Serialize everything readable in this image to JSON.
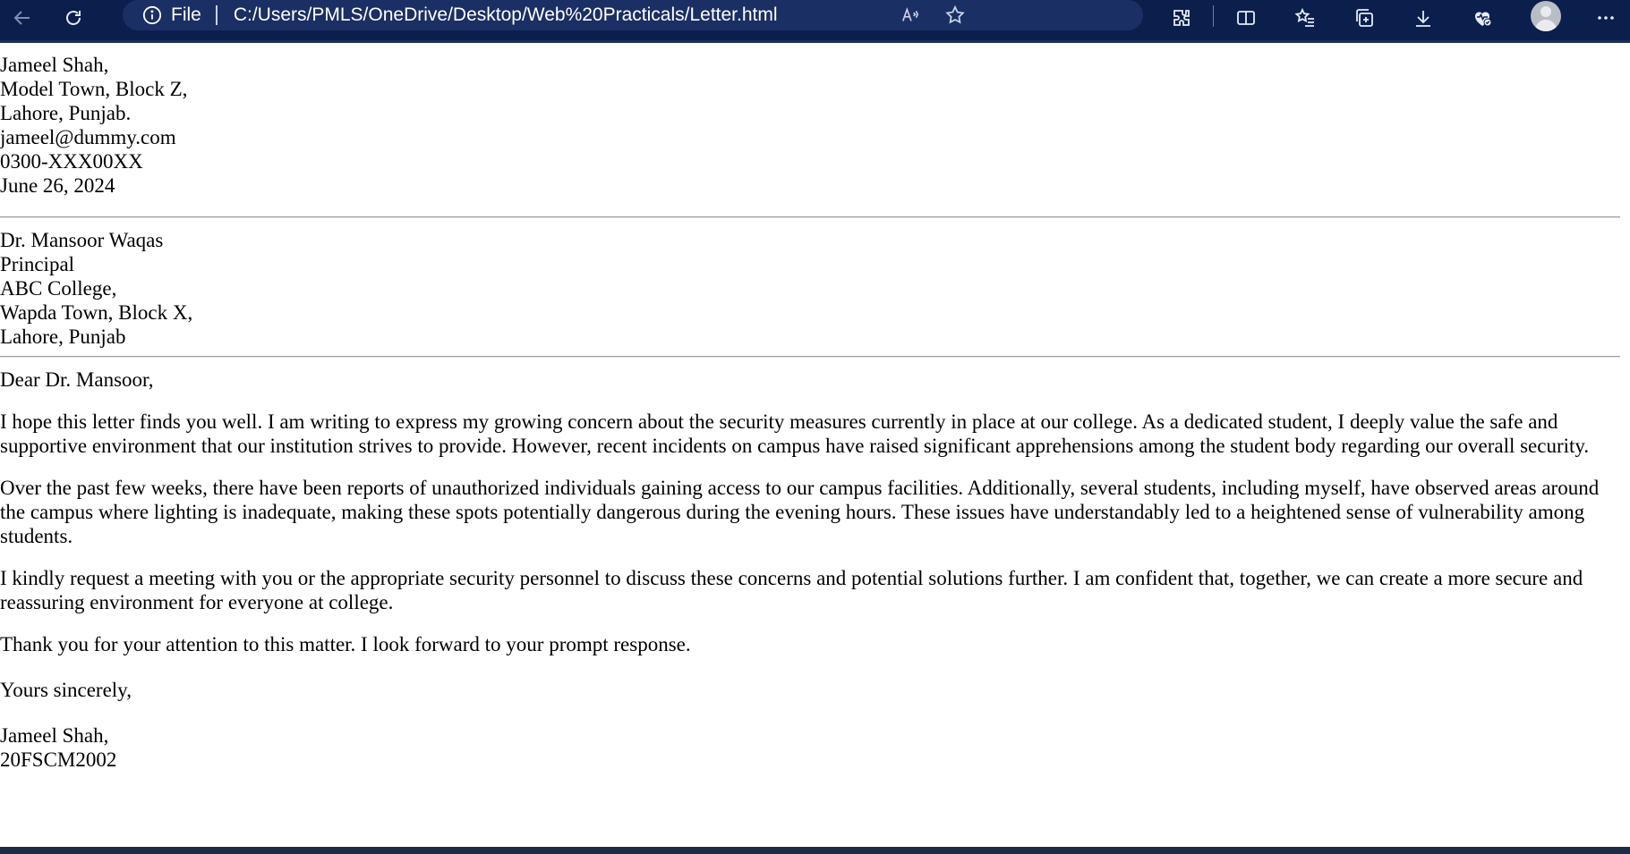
{
  "browser": {
    "file_label": "File",
    "url": "C:/Users/PMLS/OneDrive/Desktop/Web%20Practicals/Letter.html",
    "icons": [
      "back-arrow-icon",
      "refresh-icon",
      "info-icon",
      "read-aloud-icon",
      "favorite-star-icon",
      "extensions-icon",
      "split-screen-icon",
      "favorites-icon",
      "collections-icon",
      "download-icon",
      "browser-essentials-icon",
      "profile-avatar-icon",
      "more-menu-icon"
    ],
    "colors": {
      "toolbar": "#0b1f4d",
      "address_bar": "#1a2f63",
      "text": "#ffffff"
    }
  },
  "letter": {
    "sender": [
      "Jameel Shah,",
      "Model Town, Block Z,",
      "Lahore, Punjab.",
      "jameel@dummy.com",
      "0300-XXX00XX",
      "June 26, 2024"
    ],
    "recipient": [
      "Dr. Mansoor Waqas",
      "Principal",
      "ABC College,",
      "Wapda Town, Block X,",
      "Lahore, Punjab"
    ],
    "salutation": "Dear Dr. Mansoor,",
    "paragraphs": [
      "I hope this letter finds you well. I am writing to express my growing concern about the security measures currently in place at our college. As a dedicated student, I deeply value the safe and supportive environment that our institution strives to provide. However, recent incidents on campus have raised significant apprehensions among the student body regarding our overall security.",
      "Over the past few weeks, there have been reports of unauthorized individuals gaining access to our campus facilities. Additionally, several students, including myself, have observed areas around the campus where lighting is inadequate, making these spots potentially dangerous during the evening hours. These issues have understandably led to a heightened sense of vulnerability among students.",
      "I kindly request a meeting with you or the appropriate security personnel to discuss these concerns and potential solutions further. I am confident that, together, we can create a more secure and reassuring environment for everyone at college.",
      "Thank you for your attention to this matter. I look forward to your prompt response."
    ],
    "closing": "Yours sincerely,",
    "signature": [
      "Jameel Shah,",
      "20FSCM2002"
    ]
  }
}
